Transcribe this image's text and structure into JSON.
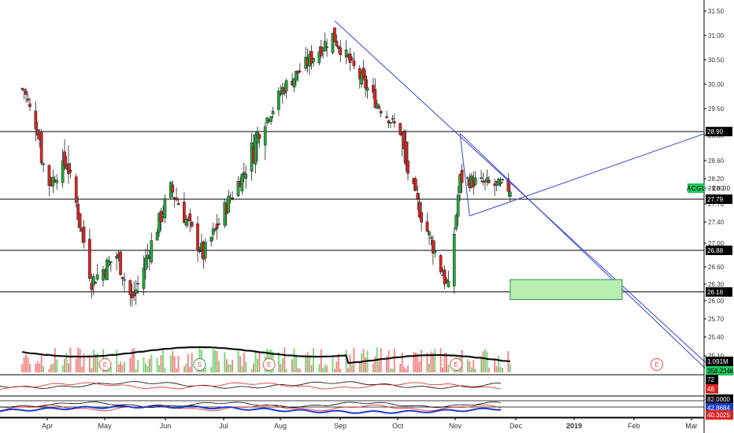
{
  "chart_data": {
    "type": "candlestick",
    "symbol": "ACGL",
    "price_axis": {
      "ticks": [
        "31.50",
        "31.00",
        "30.50",
        "30.00",
        "29.50",
        "28.80",
        "28.60",
        "28.20",
        "28.00",
        "27.70",
        "27.40",
        "27.00",
        "26.60",
        "26.30",
        "26.00",
        "25.70",
        "25.40",
        "25.10"
      ],
      "range": [
        25.0,
        31.6
      ]
    },
    "x_axis": {
      "labels": [
        "Apr",
        "May",
        "Jun",
        "Jul",
        "Aug",
        "Sep",
        "Oct",
        "Nov",
        "Dec",
        "2019",
        "Feb",
        "Mar"
      ],
      "bold_labels": [
        "2019"
      ]
    },
    "horizontal_levels": [
      {
        "price": 28.9,
        "label": "28.90",
        "color": "#000000"
      },
      {
        "price": 27.79,
        "label": "27.79",
        "color": "#000000"
      },
      {
        "price": 26.88,
        "label": "26.88",
        "color": "#000000"
      },
      {
        "price": 26.16,
        "label": "26.16",
        "color": "#000000"
      }
    ],
    "last_price": {
      "label": "ACGL · 28.00",
      "value": 28.0,
      "color": "#22c55e"
    },
    "volume": {
      "average_label": "1.091M",
      "last_label": "358.234K",
      "up_color": "#7ed87e",
      "down_color": "#f08a8a"
    },
    "event_markers": [
      {
        "letter": "E",
        "date": "2018-05-01"
      },
      {
        "letter": "S",
        "date": "2018-06-19"
      },
      {
        "letter": "E",
        "date": "2018-07-25"
      },
      {
        "letter": "E",
        "date": "2018-10-30"
      },
      {
        "letter": "E",
        "date": "2019-02-11"
      }
    ],
    "oscillator1": {
      "labels": [
        "72",
        "48"
      ],
      "colors": [
        "#000000",
        "#dd2222"
      ]
    },
    "oscillator2": {
      "labels": [
        "82.0000",
        "42.8684",
        "40.3025"
      ],
      "colors": [
        "#000000",
        "#1e3acc",
        "#dd2222"
      ]
    },
    "series": [
      {
        "name": "ACGL",
        "date_start": "2018-03-19",
        "date_end": "2018-11-27",
        "ohlc_samples": [
          [
            "2018-03-20",
            28.5,
            29.95,
            28.4,
            29.9
          ],
          [
            "2018-04-02",
            28.6,
            28.9,
            27.8,
            28.1
          ],
          [
            "2018-04-11",
            28.7,
            28.92,
            28.45,
            28.55
          ],
          [
            "2018-04-24",
            26.85,
            27.3,
            26.2,
            26.35
          ],
          [
            "2018-05-07",
            27.25,
            27.4,
            26.6,
            26.8
          ],
          [
            "2018-05-15",
            26.1,
            26.25,
            25.75,
            26.0
          ],
          [
            "2018-06-04",
            27.6,
            28.1,
            27.4,
            28.0
          ],
          [
            "2018-06-21",
            26.45,
            26.9,
            26.0,
            26.8
          ],
          [
            "2018-07-19",
            28.7,
            28.9,
            28.4,
            28.85
          ],
          [
            "2018-08-01",
            30.6,
            31.0,
            29.6,
            29.9
          ],
          [
            "2018-08-27",
            31.1,
            31.3,
            30.8,
            31.0
          ],
          [
            "2018-09-04",
            30.6,
            30.9,
            30.4,
            30.5
          ],
          [
            "2018-10-01",
            29.1,
            29.3,
            28.7,
            28.9
          ],
          [
            "2018-10-09",
            28.4,
            28.6,
            27.4,
            27.8
          ],
          [
            "2018-10-26",
            26.25,
            26.4,
            26.1,
            26.2
          ],
          [
            "2018-11-01",
            28.9,
            29.0,
            28.1,
            28.2
          ],
          [
            "2018-11-13",
            28.3,
            28.5,
            27.9,
            28.1
          ],
          [
            "2018-11-27",
            27.85,
            28.1,
            27.75,
            28.0
          ]
        ]
      }
    ],
    "trendlines": [
      {
        "from": [
          "2018-08-28",
          31.3
        ],
        "to": [
          "2019-03-08",
          25.0
        ],
        "color": "#3344cc"
      },
      {
        "from": [
          "2018-11-01",
          28.85
        ],
        "to": [
          "2019-03-08",
          24.9
        ],
        "color": "#3344cc"
      },
      {
        "from": [
          "2018-11-06",
          27.5
        ],
        "to": [
          "2019-03-08",
          28.85
        ],
        "color": "#3344cc"
      },
      {
        "from": [
          "2018-11-06",
          27.5
        ],
        "to": [
          "2018-11-01",
          28.85
        ],
        "color": "#3344cc"
      }
    ],
    "zone": {
      "from": [
        "2018-11-27",
        26.38
      ],
      "to": [
        "2019-01-24",
        26.02
      ],
      "fill": "#b7f0b0",
      "stroke": "#2e8b57"
    },
    "grid": false,
    "legend": "none"
  }
}
